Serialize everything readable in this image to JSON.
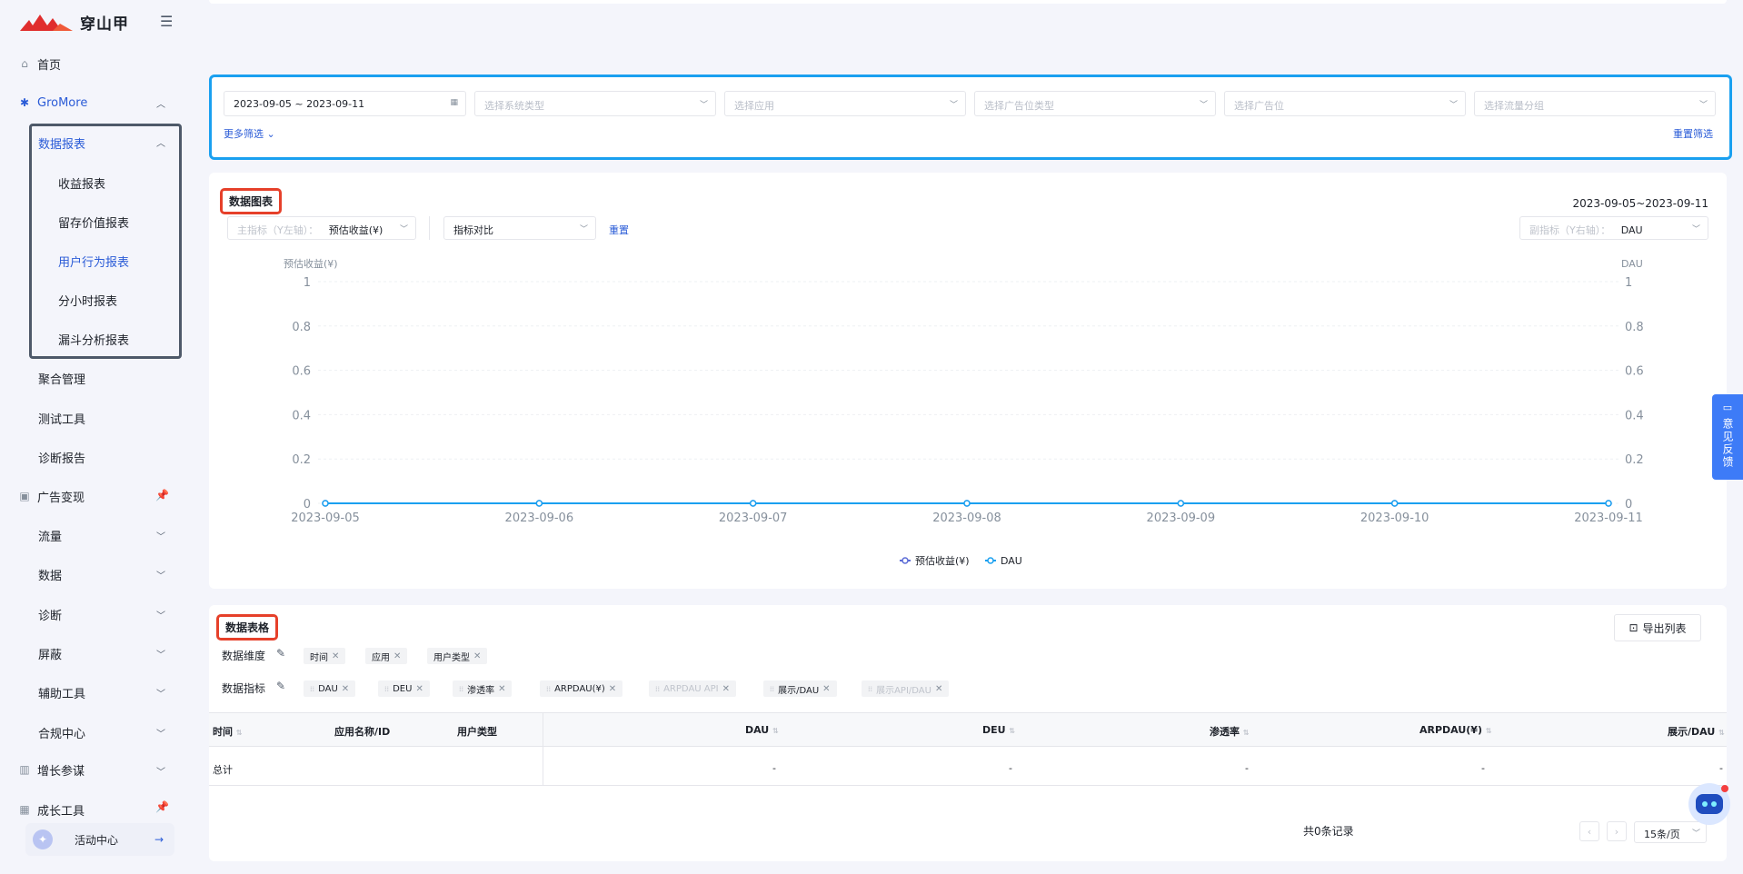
{
  "brand": {
    "name": "穿山甲"
  },
  "sidebar": {
    "home": "首页",
    "gromore": "GroMore",
    "data_report": "数据报表",
    "reports": [
      "收益报表",
      "留存价值报表",
      "用户行为报表",
      "分小时报表",
      "漏斗分析报表"
    ],
    "others": [
      "聚合管理",
      "测试工具",
      "诊断报告"
    ],
    "ad_monetize": "广告变现",
    "ad_sub": [
      "流量",
      "数据",
      "诊断",
      "屏蔽",
      "辅助工具",
      "合规中心"
    ],
    "growth_advisor": "增长参谋",
    "growth_tools": "成长工具",
    "activity": "活动中心"
  },
  "filters": {
    "date_range": "2023-09-05 ~ 2023-09-11",
    "system_type": "选择系统类型",
    "app": "选择应用",
    "ad_slot_type": "选择广告位类型",
    "ad_slot": "选择广告位",
    "traffic_group": "选择流量分组",
    "more": "更多筛选",
    "reset": "重置筛选"
  },
  "chart_section": {
    "title": "数据图表",
    "date_range": "2023-09-05~2023-09-11",
    "primary_label": "主指标（Y左轴）：",
    "primary_value": "预估收益(¥)",
    "compare": "指标对比",
    "reset": "重置",
    "secondary_label": "副指标（Y右轴）：",
    "secondary_value": "DAU"
  },
  "chart_data": {
    "type": "line",
    "x": [
      "2023-09-05",
      "2023-09-06",
      "2023-09-07",
      "2023-09-08",
      "2023-09-09",
      "2023-09-10",
      "2023-09-11"
    ],
    "series": [
      {
        "name": "预估收益(¥)",
        "values": [
          0,
          0,
          0,
          0,
          0,
          0,
          0
        ],
        "color": "#5b6bd6"
      },
      {
        "name": "DAU",
        "values": [
          0,
          0,
          0,
          0,
          0,
          0,
          0
        ],
        "color": "#1aa0f0"
      }
    ],
    "ylabel_left": "预估收益(¥)",
    "ylabel_right": "DAU",
    "yticks": [
      "0",
      "0.2",
      "0.4",
      "0.6",
      "0.8",
      "1"
    ],
    "ylim": [
      0,
      1
    ],
    "legend": "bottom-center"
  },
  "table_section": {
    "title": "数据表格",
    "export": "导出列表",
    "dim_label": "数据维度",
    "dims": [
      "时间",
      "应用",
      "用户类型"
    ],
    "metric_label": "数据指标",
    "metrics": [
      {
        "label": "DAU",
        "disabled": false
      },
      {
        "label": "DEU",
        "disabled": false
      },
      {
        "label": "渗透率",
        "disabled": false
      },
      {
        "label": "ARPDAU(¥)",
        "disabled": false
      },
      {
        "label": "ARPDAU API",
        "disabled": true
      },
      {
        "label": "展示/DAU",
        "disabled": false
      },
      {
        "label": "展示API/DAU",
        "disabled": true
      }
    ],
    "columns": [
      "时间",
      "应用名称/ID",
      "用户类型",
      "DAU",
      "DEU",
      "渗透率",
      "ARPDAU(¥)",
      "展示/DAU"
    ],
    "rows": [
      [
        "总计",
        "",
        "",
        "-",
        "-",
        "-",
        "-",
        "-"
      ]
    ]
  },
  "pagination": {
    "total": "共0条记录",
    "page_size": "15条/页"
  },
  "feedback": "意见反馈"
}
